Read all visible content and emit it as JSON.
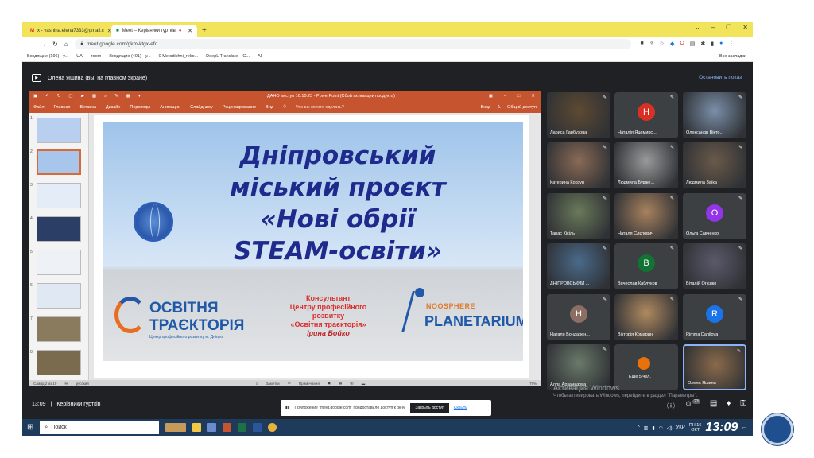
{
  "browser": {
    "tabs": [
      {
        "label": "x - yashina.elena7333@gmail.c"
      },
      {
        "label": "Meet – Керівники гуртків"
      }
    ],
    "url": "meet.google.com/gkm-ktgx-efo",
    "bookmarks": [
      "Входящие (196) - y...",
      "UA",
      "zoom",
      "Входящие (401) - y...",
      "0 Metodichni_reko...",
      "DeepL Translate – C...",
      "AI"
    ],
    "bookmarks_right": "Все закладки"
  },
  "meet": {
    "presenter_text": "Олена Яшина (вы, на главном экране)",
    "stop_show": "Остановить показ",
    "time": "13:09",
    "meeting_name": "Керівники гуртків",
    "notice_text": "Приложение \"meet.google.com\" предоставило доступ к окну.",
    "notice_button": "Закрыть доступ",
    "notice_link": "Скрыть",
    "win_activation_title": "Активация Windows",
    "win_activation_sub": "Чтобы активировать Windows, перейдите в раздел \"Параметры\".",
    "participants_count": "23",
    "participants": [
      {
        "name": "Лариса Гарбузова",
        "type": "photo",
        "color": "#5d4a32"
      },
      {
        "name": "Наталія Яцемирс...",
        "type": "avatar",
        "letter": "Н",
        "color": "#d93025"
      },
      {
        "name": "Олександр Вікто...",
        "type": "photo",
        "color": "#7a8fa8"
      },
      {
        "name": "Катерина Корзун",
        "type": "photo",
        "color": "#8a6a55"
      },
      {
        "name": "Людмила Будже...",
        "type": "photo",
        "color": "#9a9a9a"
      },
      {
        "name": "Людмила Заїка",
        "type": "photo",
        "color": "#6a5a4a"
      },
      {
        "name": "Тарас Кісіль",
        "type": "photo",
        "color": "#6a7a5a"
      },
      {
        "name": "Наталя Слєпович",
        "type": "photo",
        "color": "#a8825e"
      },
      {
        "name": "Ольга Савченко",
        "type": "avatar",
        "letter": "О",
        "color": "#9334e6"
      },
      {
        "name": "ДНІПРОВСЬКИЙ ...",
        "type": "photo",
        "color": "#4a6a8a"
      },
      {
        "name": "Вячеслав Каблуков",
        "type": "avatar",
        "letter": "В",
        "color": "#137333"
      },
      {
        "name": "Віталій Огієнко",
        "type": "photo",
        "color": "#5a5a6a"
      },
      {
        "name": "Наталя Бондарен...",
        "type": "avatar",
        "letter": "Н",
        "color": "#8d6e63"
      },
      {
        "name": "Вікторія Комарин",
        "type": "photo",
        "color": "#b08a60"
      },
      {
        "name": "Rimma Danilova",
        "type": "avatar",
        "letter": "R",
        "color": "#1a73e8"
      },
      {
        "name": "Алла Арзамазова",
        "type": "photo",
        "color": "#6a7a6a"
      },
      {
        "name": "Ещё 5 чел.",
        "type": "more",
        "color": "#e8710a"
      },
      {
        "name": "Олена Яшина",
        "type": "photo",
        "color": "#8a6a4a"
      }
    ]
  },
  "ppt": {
    "window_title": "ДАНО виступ 16.10.23 - PowerPoint (Сбой активации продукта)",
    "menu": [
      "Файл",
      "Главная",
      "Вставка",
      "Дизайн",
      "Переходы",
      "Анимации",
      "Слайд-шоу",
      "Рецензирование",
      "Вид"
    ],
    "tell_me": "Что вы хотите сделать?",
    "sign_in": "Вход",
    "share": "Общий доступ",
    "slide_numbers": [
      "1",
      "2",
      "3",
      "4",
      "5",
      "6",
      "7",
      "8"
    ],
    "status_left": "Слайд 2 из 19",
    "status_lang": "русский",
    "status_notes": "Заметки",
    "status_comments": "Примечания",
    "status_zoom": "79%",
    "slide": {
      "line1": "Дніпровський",
      "line2": "міський проєкт",
      "line3": "«Нові обрії",
      "line4": "STEAM-освіти»",
      "logo1_line1": "ОСВІТНЯ",
      "logo1_line2": "ТРАЄКТОРІЯ",
      "logo1_sub": "Центр професійного розвитку м. Дніпро",
      "consult_line1": "Консультант",
      "consult_line2": "Центру професійного",
      "consult_line3": "розвитку",
      "consult_line4": "«Освітня траєкторія»",
      "consult_name": "Ірина Бойко",
      "logo2_line1": "NOOSPHERE",
      "logo2_line2": "PLANETARIUM"
    }
  },
  "taskbar": {
    "search_placeholder": "Поиск",
    "lang": "УКР",
    "day": "ПН",
    "date_num": "16",
    "month": "ОКТ",
    "time": "13:09"
  }
}
